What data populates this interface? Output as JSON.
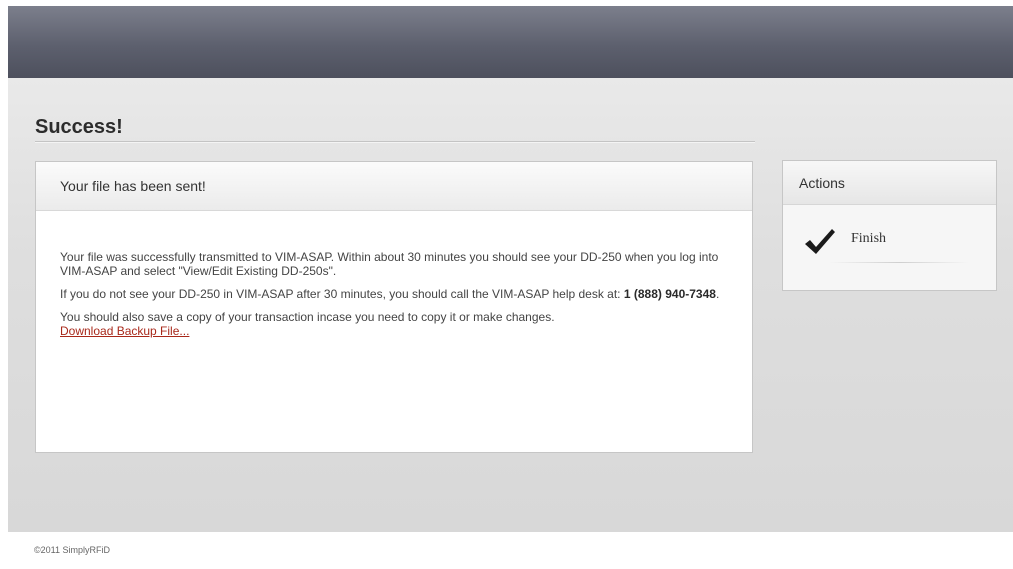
{
  "page": {
    "title": "Success!"
  },
  "main_panel": {
    "header": "Your file has been sent!",
    "paragraph1": "Your file was successfully transmitted to VIM-ASAP. Within about 30 minutes you should see your DD-250 when you log into VIM-ASAP and select \"View/Edit Existing DD-250s\".",
    "paragraph2_text": "If you do not see your DD-250 in VIM-ASAP after 30 minutes, you should call the VIM-ASAP help desk at: ",
    "phone": "1 (888) 940-7348",
    "paragraph2_end": ".",
    "paragraph3": "You should also save a copy of your transaction incase you need to copy it or make changes.",
    "download_link": "Download Backup File..."
  },
  "actions": {
    "header": "Actions",
    "finish_label": "Finish",
    "finish_icon": "checkmark-icon"
  },
  "footer": {
    "copyright": "©2011 SimplyRFiD"
  },
  "colors": {
    "header_bar": "#5d606e",
    "link": "#a8281a",
    "background": "#dedede"
  }
}
